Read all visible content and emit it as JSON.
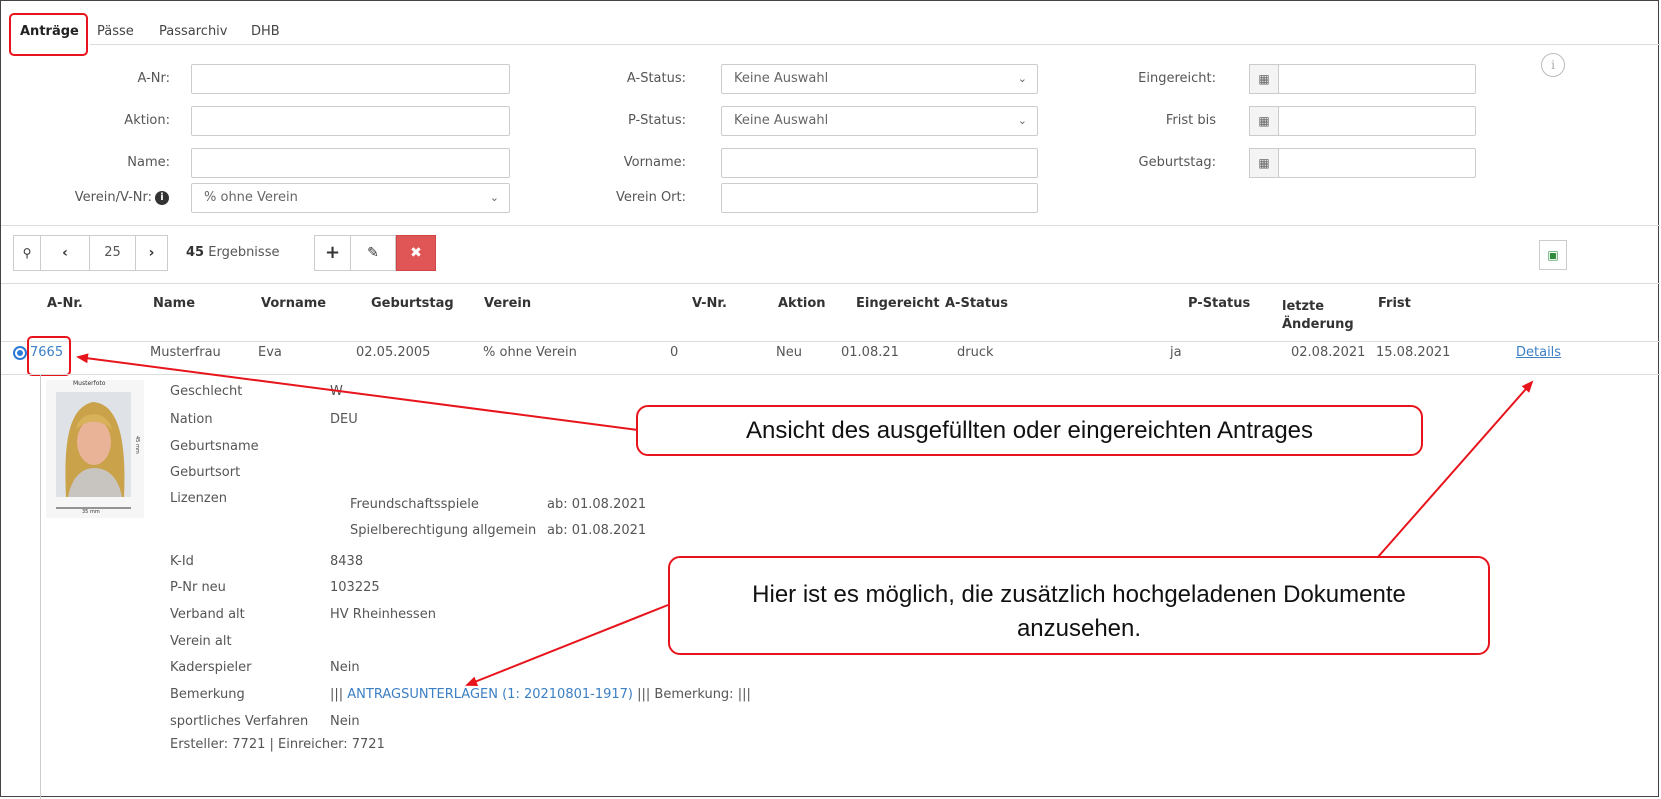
{
  "tabs": [
    "Anträge",
    "Pässe",
    "Passarchiv",
    "DHB"
  ],
  "filters": {
    "a_nr": "A-Nr:",
    "aktion": "Aktion:",
    "name": "Name:",
    "verein": "Verein/V-Nr:",
    "verein_value": "% ohne Verein",
    "a_status": "A-Status:",
    "a_status_value": "Keine Auswahl",
    "p_status": "P-Status:",
    "p_status_value": "Keine Auswahl",
    "vorname": "Vorname:",
    "verein_ort": "Verein Ort:",
    "eingereicht": "Eingereicht:",
    "frist_bis": "Frist bis",
    "geburtstag": "Geburtstag:"
  },
  "toolbar": {
    "page_size": "25",
    "results_count": "45",
    "results_label": "Ergebnisse"
  },
  "table": {
    "headers": [
      "A-Nr.",
      "Name",
      "Vorname",
      "Geburtstag",
      "Verein",
      "V-Nr.",
      "Aktion",
      "Eingereicht",
      "A-Status",
      "P-Status",
      "letzte Änderung",
      "Frist"
    ],
    "row": {
      "a_nr": "7665",
      "name": "Musterfrau",
      "vorname": "Eva",
      "geburtstag": "02.05.2005",
      "verein": "% ohne Verein",
      "v_nr": "0",
      "aktion": "Neu",
      "eingereicht": "01.08.21",
      "a_status": "druck",
      "p_status": "ja",
      "letzte_aenderung": "02.08.2021",
      "frist": "15.08.2021",
      "details": "Details"
    }
  },
  "photo": {
    "caption": "Musterfoto",
    "height_label": "45 mm",
    "width_label": "35 mm"
  },
  "details": {
    "geschlecht_l": "Geschlecht",
    "geschlecht_v": "W",
    "nation_l": "Nation",
    "nation_v": "DEU",
    "geburtsname_l": "Geburtsname",
    "geburtsort_l": "Geburtsort",
    "lizenzen_l": "Lizenzen",
    "lizenz1": "Freundschaftsspiele",
    "lizenz1_ab": "ab: 01.08.2021",
    "lizenz2": "Spielberechtigung allgemein",
    "lizenz2_ab": "ab: 01.08.2021",
    "kid_l": "K-Id",
    "kid_v": "8438",
    "pnr_l": "P-Nr neu",
    "pnr_v": "103225",
    "verband_l": "Verband alt",
    "verband_v": "HV Rheinhessen",
    "vereinalt_l": "Verein alt",
    "kader_l": "Kaderspieler",
    "kader_v": "Nein",
    "bemerkung_l": "Bemerkung",
    "bem_sep1": "|||",
    "bem_link": "ANTRAGSUNTERLAGEN (1: 20210801-1917)",
    "bem_rest": "||| Bemerkung: |||",
    "sport_l": "sportliches Verfahren",
    "sport_v": "Nein",
    "ersteller": "Ersteller: 7721 | Einreicher: 7721"
  },
  "callouts": {
    "top": "Ansicht des ausgefüllten oder eingereichten Antrages",
    "bottom": "Hier ist es möglich, die zusätzlich hochgeladenen Dokumente anzusehen."
  },
  "colors": {
    "highlight": "#e8141b",
    "link": "#3b7fc4",
    "delete": "#e05555",
    "excel": "#2e8b3a"
  }
}
